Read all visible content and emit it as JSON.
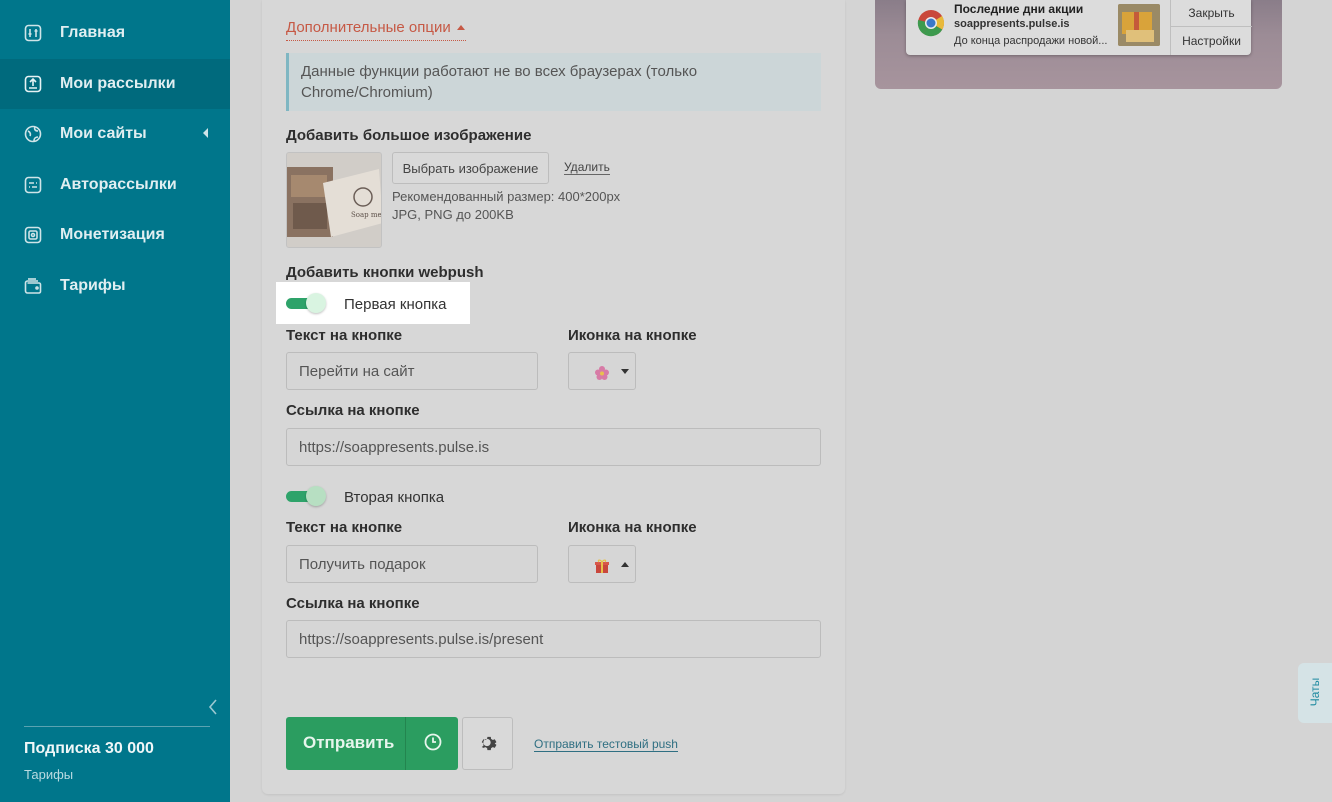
{
  "sidebar": {
    "items": [
      {
        "label": "Главная",
        "icon": "sliders-icon"
      },
      {
        "label": "Мои рассылки",
        "icon": "upload-box-icon",
        "active": true
      },
      {
        "label": "Мои сайты",
        "icon": "globe-icon"
      },
      {
        "label": "Авторассылки",
        "icon": "auto-icon"
      },
      {
        "label": "Монетизация",
        "icon": "coin-icon"
      },
      {
        "label": "Тарифы",
        "icon": "wallet-icon"
      }
    ],
    "subscription": "Подписка 30 000",
    "tariffs_link": "Тарифы"
  },
  "form": {
    "advanced_link": "Дополнительные опции",
    "info": "Данные функции работают не во всех браузерах (только Chrome/Chromium)",
    "big_image_label": "Добавить большое изображение",
    "choose_image": "Выбрать изображение",
    "delete": "Удалить",
    "hint_size": "Рекомендованный размер: 400*200px",
    "hint_format": "JPG, PNG до 200KB",
    "webpush_label": "Добавить кнопки webpush",
    "button1": {
      "toggle_label": "Первая кнопка",
      "text_label": "Текст на кнопке",
      "icon_label": "Иконка на кнопке",
      "text_value": "Перейти на сайт",
      "link_label": "Ссылка на кнопке",
      "link_value": "https://soappresents.pulse.is"
    },
    "button2": {
      "toggle_label": "Вторая кнопка",
      "text_label": "Текст на кнопке",
      "icon_label": "Иконка на кнопке",
      "text_value": "Получить подарок",
      "link_label": "Ссылка на кнопке",
      "link_value": "https://soappresents.pulse.is/present"
    },
    "send": "Отправить",
    "test_push": "Отправить тестовый push"
  },
  "preview": {
    "title": "Последние дни акции",
    "site": "soappresents.pulse.is",
    "body": "До конца распродажи новой...",
    "close": "Закрыть",
    "settings": "Настройки"
  },
  "chat": "Чаты",
  "colors": {
    "sidebar": "#00768b",
    "accent_green": "#2b9d60",
    "link_red": "#c65945"
  }
}
